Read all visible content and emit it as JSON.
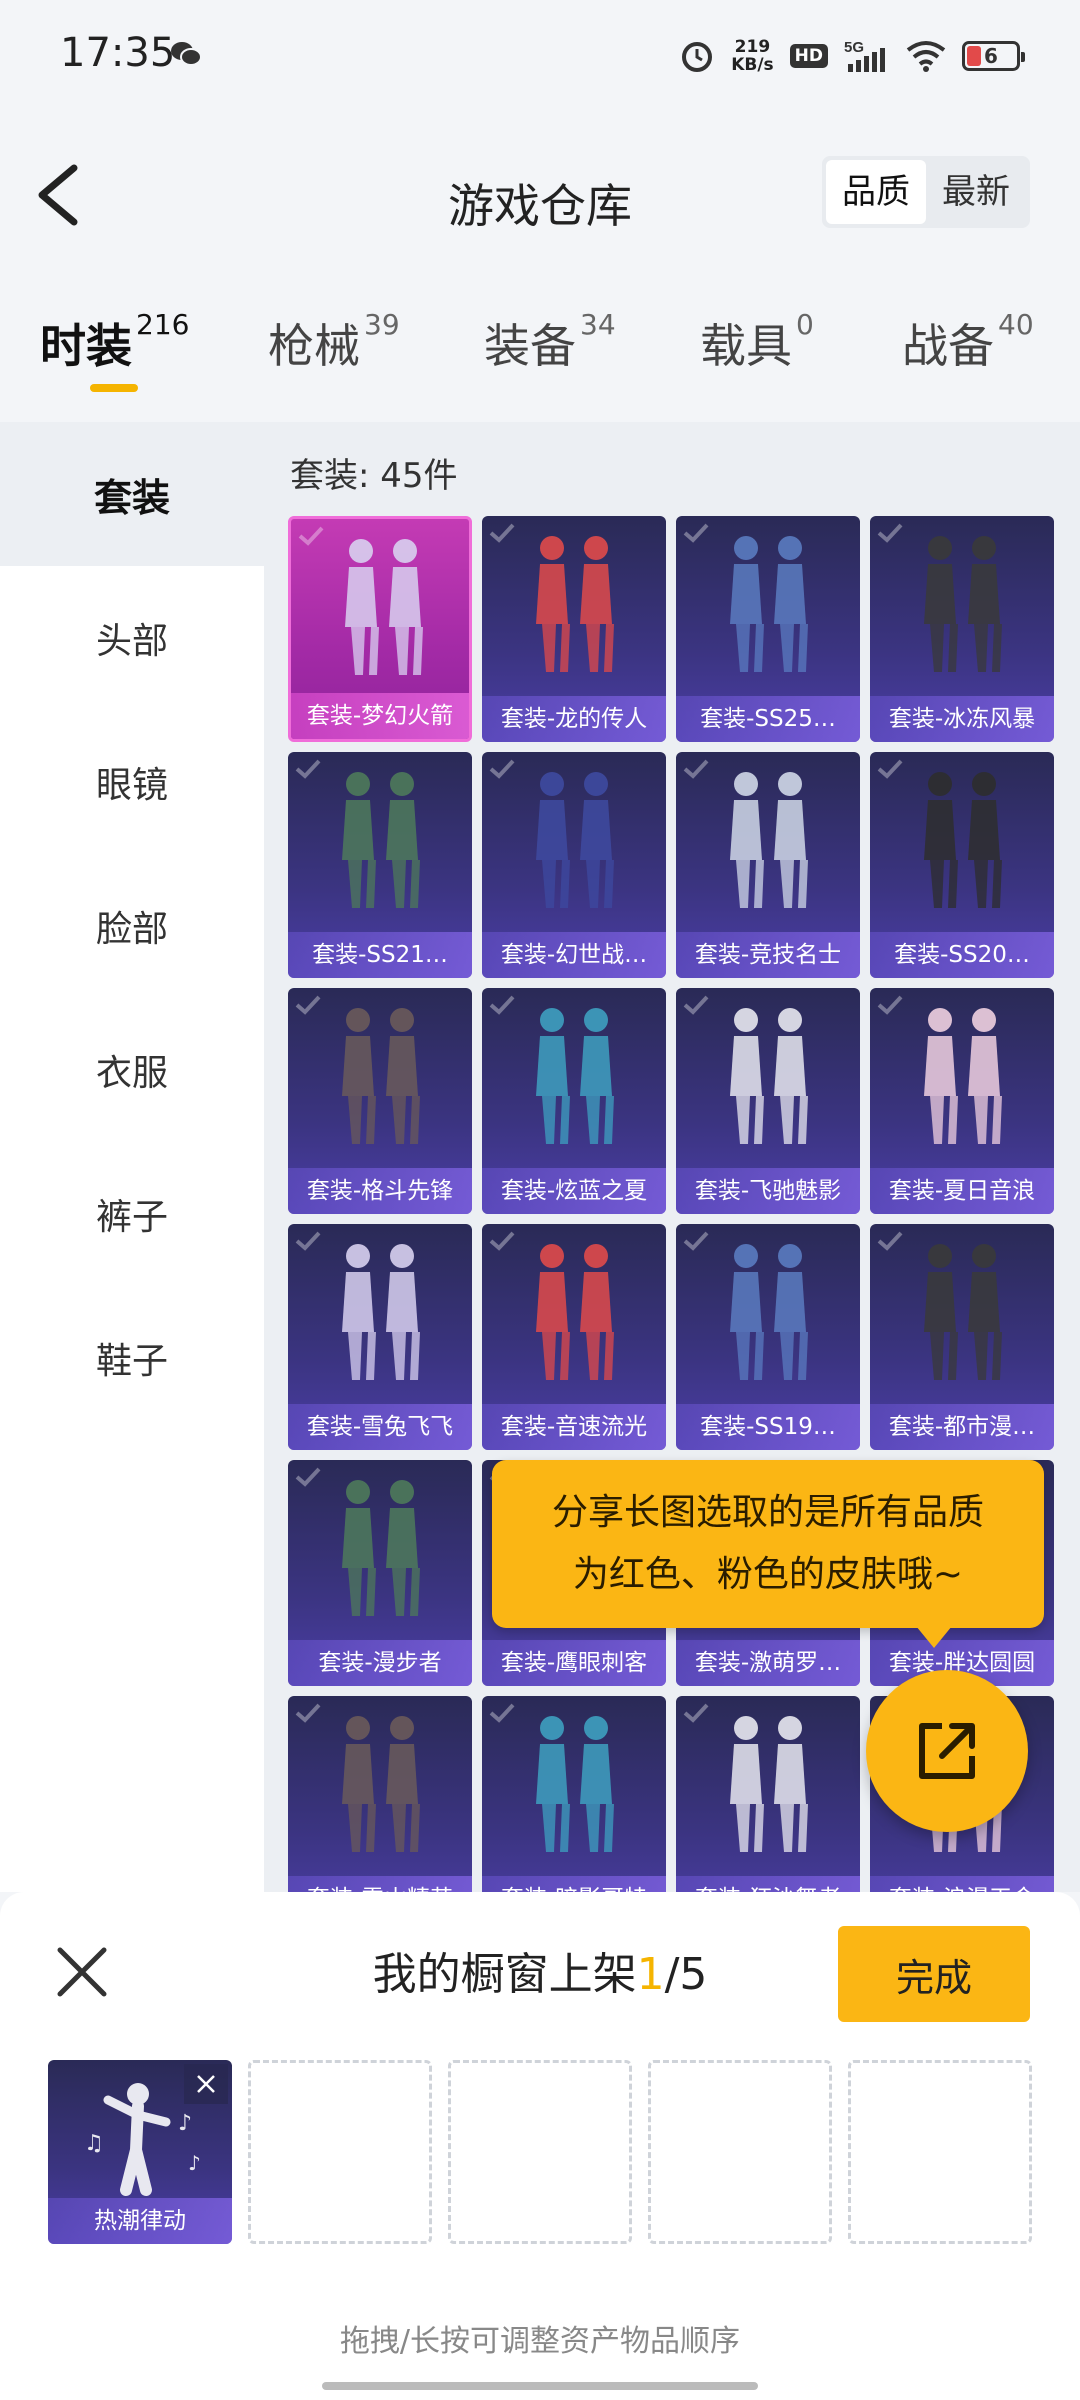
{
  "status_bar": {
    "time": "17:35",
    "net_speed_value": "219",
    "net_speed_unit": "KB/s",
    "hd": "HD",
    "network": "5G",
    "battery": "6",
    "icons": [
      "wechat-icon",
      "alarm-icon",
      "signal-icon",
      "wifi-icon",
      "battery-icon"
    ]
  },
  "header": {
    "title": "游戏仓库",
    "sort_options": [
      {
        "label": "品质",
        "active": true
      },
      {
        "label": "最新",
        "active": false
      }
    ]
  },
  "category_tabs": [
    {
      "label": "时装",
      "count": "216",
      "active": true
    },
    {
      "label": "枪械",
      "count": "39",
      "active": false
    },
    {
      "label": "装备",
      "count": "34",
      "active": false
    },
    {
      "label": "载具",
      "count": "0",
      "active": false
    },
    {
      "label": "战备",
      "count": "40",
      "active": false
    }
  ],
  "sidebar": {
    "items": [
      {
        "label": "套装",
        "active": true
      },
      {
        "label": "头部",
        "active": false
      },
      {
        "label": "眼镜",
        "active": false
      },
      {
        "label": "脸部",
        "active": false
      },
      {
        "label": "衣服",
        "active": false
      },
      {
        "label": "裤子",
        "active": false
      },
      {
        "label": "鞋子",
        "active": false
      }
    ]
  },
  "grid": {
    "count_text": "套装: 45件",
    "items": [
      {
        "label": "套装-梦幻火箭",
        "rarity": "pink"
      },
      {
        "label": "套装-龙的传人",
        "rarity": "purple"
      },
      {
        "label": "套装-SS25…",
        "rarity": "purple"
      },
      {
        "label": "套装-冰冻风暴",
        "rarity": "purple"
      },
      {
        "label": "套装-SS21…",
        "rarity": "purple"
      },
      {
        "label": "套装-幻世战…",
        "rarity": "purple"
      },
      {
        "label": "套装-竞技名士",
        "rarity": "purple"
      },
      {
        "label": "套装-SS20…",
        "rarity": "purple"
      },
      {
        "label": "套装-格斗先锋",
        "rarity": "purple"
      },
      {
        "label": "套装-炫蓝之夏",
        "rarity": "purple"
      },
      {
        "label": "套装-飞驰魅影",
        "rarity": "purple"
      },
      {
        "label": "套装-夏日音浪",
        "rarity": "purple"
      },
      {
        "label": "套装-雪兔飞飞",
        "rarity": "purple"
      },
      {
        "label": "套装-音速流光",
        "rarity": "purple"
      },
      {
        "label": "套装-SS19…",
        "rarity": "purple"
      },
      {
        "label": "套装-都市漫…",
        "rarity": "purple"
      },
      {
        "label": "套装-漫步者",
        "rarity": "purple"
      },
      {
        "label": "套装-鹰眼刺客",
        "rarity": "purple"
      },
      {
        "label": "套装-激萌罗…",
        "rarity": "purple"
      },
      {
        "label": "套装-胖达圆圆",
        "rarity": "purple"
      },
      {
        "label": "套装-雪山精英",
        "rarity": "purple"
      },
      {
        "label": "套装-暗影哥特",
        "rarity": "purple"
      },
      {
        "label": "套装-狂沙舞者",
        "rarity": "purple"
      },
      {
        "label": "套装-浪漫天命",
        "rarity": "purple"
      }
    ]
  },
  "tooltip": {
    "line1": "分享长图选取的是所有品质",
    "line2": "为红色、粉色的皮肤哦~"
  },
  "share_button": {
    "icon": "share-icon"
  },
  "showcase": {
    "title_prefix": "我的橱窗上架",
    "current": "1",
    "total_text": "/5",
    "done_label": "完成",
    "slots": [
      {
        "label": "热潮律动",
        "filled": true
      },
      {
        "label": "",
        "filled": false
      },
      {
        "label": "",
        "filled": false
      },
      {
        "label": "",
        "filled": false
      },
      {
        "label": "",
        "filled": false
      }
    ],
    "hint": "拖拽/长按可调整资产物品顺序"
  },
  "colors": {
    "accent": "#fbb614",
    "purple_card": "#3b3481",
    "pink_card": "#c43bb4",
    "background": "#f3f5f8"
  }
}
